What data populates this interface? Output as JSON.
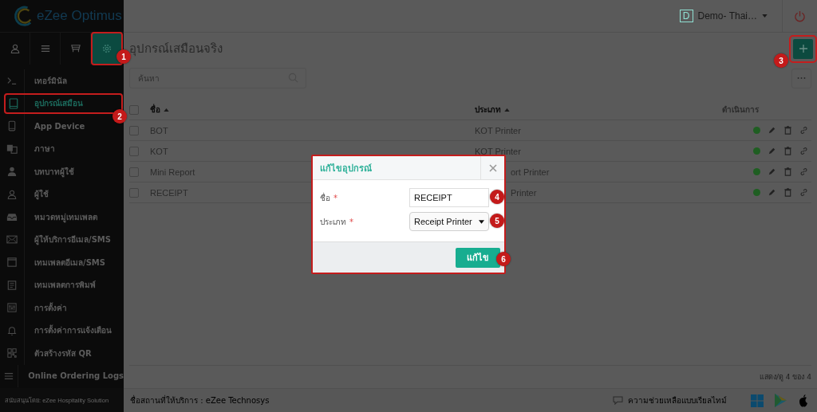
{
  "app": {
    "logo_text": "eZee Optimus"
  },
  "header": {
    "property_initial": "D",
    "property_name": "Demo- Thai…"
  },
  "sidebar": {
    "tabs": [
      {
        "selected": false
      },
      {
        "selected": false
      },
      {
        "selected": false
      },
      {
        "selected": true
      }
    ],
    "items": [
      {
        "label": "เทอร์มินัล",
        "selected": false
      },
      {
        "label": "อุปกรณ์เสมือน",
        "selected": true
      },
      {
        "label": "App Device",
        "selected": false
      },
      {
        "label": "ภาษา",
        "selected": false
      },
      {
        "label": "บทบาทผู้ใช้",
        "selected": false
      },
      {
        "label": "ผู้ใช้",
        "selected": false
      },
      {
        "label": "หมวดหมู่เทมเพลต",
        "selected": false
      },
      {
        "label": "ผู้ให้บริการอีเมล/SMS",
        "selected": false
      },
      {
        "label": "เทมเพลตอีเมล/SMS",
        "selected": false
      },
      {
        "label": "เทมเพลตการพิมพ์",
        "selected": false
      },
      {
        "label": "การตั้งค่า",
        "selected": false
      },
      {
        "label": "การตั้งค่าการแจ้งเตือน",
        "selected": false
      },
      {
        "label": "ตัวสร้างรหัส QR",
        "selected": false
      },
      {
        "label": "Online Ordering Logs",
        "selected": false
      }
    ],
    "footer": "สนับสนุนโดย: eZee Hospitality Solution"
  },
  "page": {
    "title": "อุปกรณ์เสมือนจริง",
    "search": {
      "placeholder": "ค้นหา"
    },
    "table": {
      "all_checked": false,
      "columns": [
        {
          "label": "ชื่อ",
          "sorted": true
        },
        {
          "label": "ประเภท",
          "sorted": true
        },
        {
          "label": "ดำเนินการ"
        }
      ],
      "rows": [
        {
          "name": "BOT",
          "type": "KOT Printer",
          "partly_hidden": false,
          "active": true,
          "checked": false
        },
        {
          "name": "KOT",
          "type": "KOT Printer",
          "partly_hidden": false,
          "active": true,
          "checked": false
        },
        {
          "name": "Mini Report",
          "type": "ort Printer",
          "partly_hidden": true,
          "active": true,
          "checked": false
        },
        {
          "name": "RECEIPT",
          "type": "Printer",
          "partly_hidden": true,
          "active": true,
          "checked": false
        }
      ]
    },
    "pagination": "แสดง/ดู 4 ของ 4"
  },
  "dialog": {
    "title": "แก้ไขอุปกรณ์",
    "fields": [
      {
        "label": "ชื่อ",
        "required_mark": "*",
        "kind": "text",
        "value": "RECEIPT"
      },
      {
        "label": "ประเภท",
        "required_mark": "*",
        "kind": "select",
        "value": "Receipt Printer"
      }
    ],
    "submit": "แก้ไข"
  },
  "footer": {
    "provider": "ชื่อสถานที่ให้บริการ : eZee Technosys",
    "help": "ความช่วยเหลือแบบเรียลไทม์"
  },
  "annotations": [
    {
      "label": "1"
    },
    {
      "label": "2"
    },
    {
      "label": "3"
    },
    {
      "label": "4"
    },
    {
      "label": "5"
    },
    {
      "label": "6"
    }
  ]
}
